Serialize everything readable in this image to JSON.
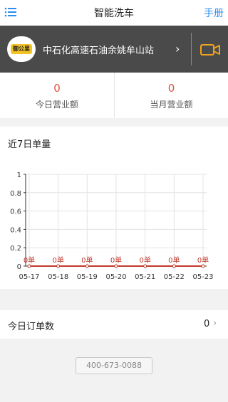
{
  "header": {
    "title": "智能洗车",
    "manual_label": "手册",
    "menu_icon": "menu-list-icon"
  },
  "station": {
    "logo_text": "御公里",
    "name": "中石化高速石油余姚牟山站",
    "chevron": "›",
    "camera_icon": "video-camera-icon"
  },
  "stats": {
    "today_value": "0",
    "today_label": "今日营业额",
    "month_value": "0",
    "month_label": "当月营业额"
  },
  "chart": {
    "title": "近7日单量"
  },
  "chart_data": {
    "type": "line",
    "title": "近7日单量",
    "categories": [
      "05-17",
      "05-18",
      "05-19",
      "05-20",
      "05-21",
      "05-22",
      "05-23"
    ],
    "series": [
      {
        "values": [
          0,
          0,
          0,
          0,
          0,
          0,
          0
        ]
      }
    ],
    "data_labels": [
      "0单",
      "0单",
      "0单",
      "0单",
      "0单",
      "0单",
      "0单"
    ],
    "y_ticks": [
      "0",
      "0.2",
      "0.4",
      "0.6",
      "0.8",
      "1"
    ],
    "ylim": [
      0,
      1
    ],
    "grid": true,
    "colors": {
      "line": "#c0392b",
      "grid": "#e3e3e3",
      "axis": "#333333"
    }
  },
  "orders": {
    "label": "今日订单数",
    "count": "0",
    "chevron": "›"
  },
  "footer": {
    "phone": "400-673-0088"
  }
}
